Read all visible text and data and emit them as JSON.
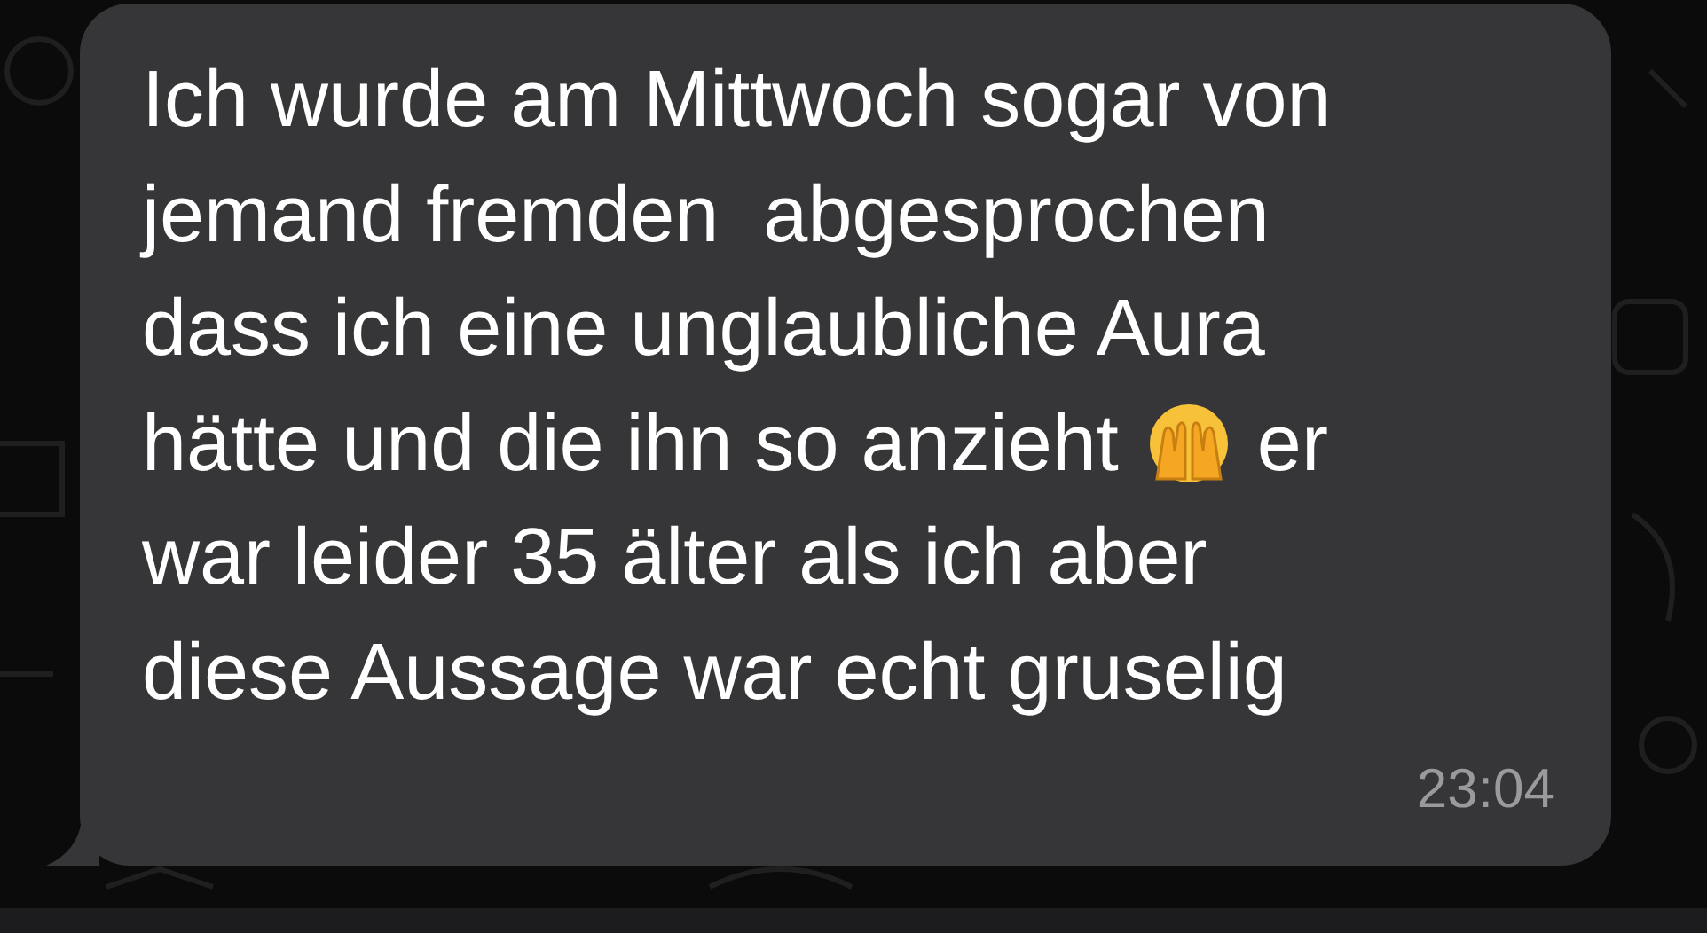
{
  "message": {
    "lines": [
      [
        {
          "kind": "text",
          "text": "Ich wurde am Mittwoch sogar von"
        }
      ],
      [
        {
          "kind": "text",
          "text": "jemand fremden  abgesprochen"
        }
      ],
      [
        {
          "kind": "text",
          "text": "dass ich eine unglaubliche Aura"
        }
      ],
      [
        {
          "kind": "text",
          "text": "hätte und die ihn so anzieht"
        },
        {
          "kind": "emoji"
        },
        {
          "kind": "text",
          "text": "er"
        }
      ],
      [
        {
          "kind": "text",
          "text": "war leider 35 älter als ich aber"
        }
      ],
      [
        {
          "kind": "text",
          "text": "diese Aussage war echt gruselig"
        }
      ]
    ],
    "time": "23:04"
  }
}
